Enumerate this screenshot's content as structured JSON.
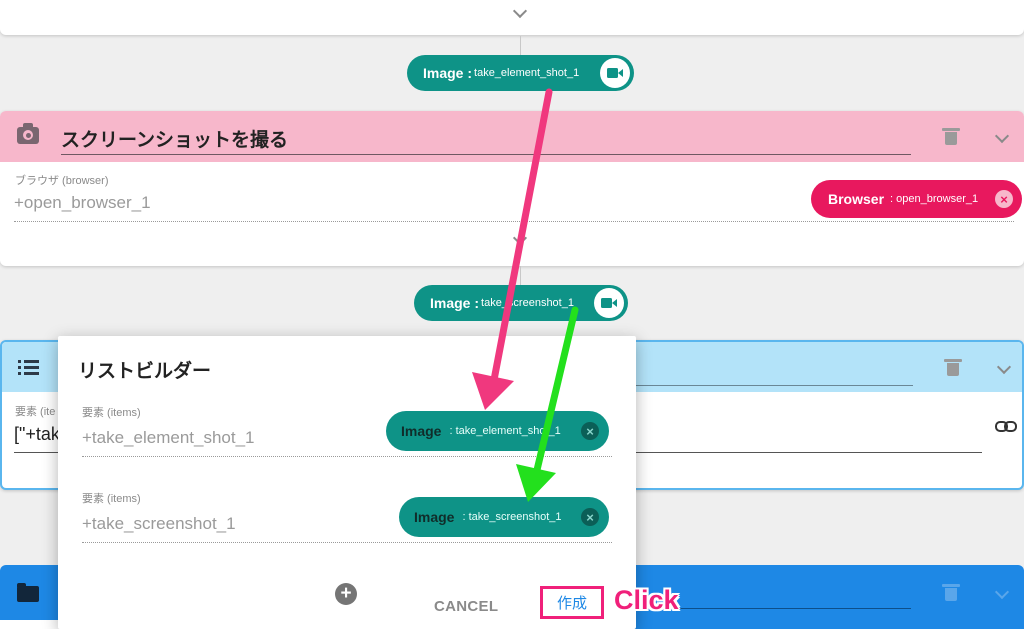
{
  "top_card": {},
  "node1": {
    "label": "Image :",
    "value": "take_element_shot_1",
    "icon": "video-camera-icon"
  },
  "screenshot_block": {
    "title": "スクリーンショットを撮る",
    "header_color": "#f7b7cb",
    "field_label": "ブラウザ (browser)",
    "field_value": "+open_browser_1",
    "chip_label": "Browser",
    "chip_value": ": open_browser_1",
    "chip_color": "#e8185e"
  },
  "node2": {
    "label": "Image :",
    "value": "take_screenshot_1",
    "icon": "video-camera-icon"
  },
  "list_block": {
    "header_color": "#b3e3f9",
    "field_label": "要素 (ite",
    "field_value": "[\"+tak"
  },
  "dialog": {
    "title": "リストビルダー",
    "items": [
      {
        "label": "要素 (items)",
        "value": "+take_element_shot_1",
        "chip_label": "Image",
        "chip_value": ": take_element_shot_1"
      },
      {
        "label": "要素 (items)",
        "value": "+take_screenshot_1",
        "chip_label": "Image",
        "chip_value": ": take_screenshot_1"
      }
    ],
    "cancel": "CANCEL",
    "create": "作成"
  },
  "annotation": {
    "text": "Click",
    "color": "#f0207a"
  },
  "arrows": {
    "pink": "#f0387e",
    "green": "#23e01d"
  },
  "colors": {
    "teal": "#0e9387",
    "blue_header": "#1e88e5"
  }
}
